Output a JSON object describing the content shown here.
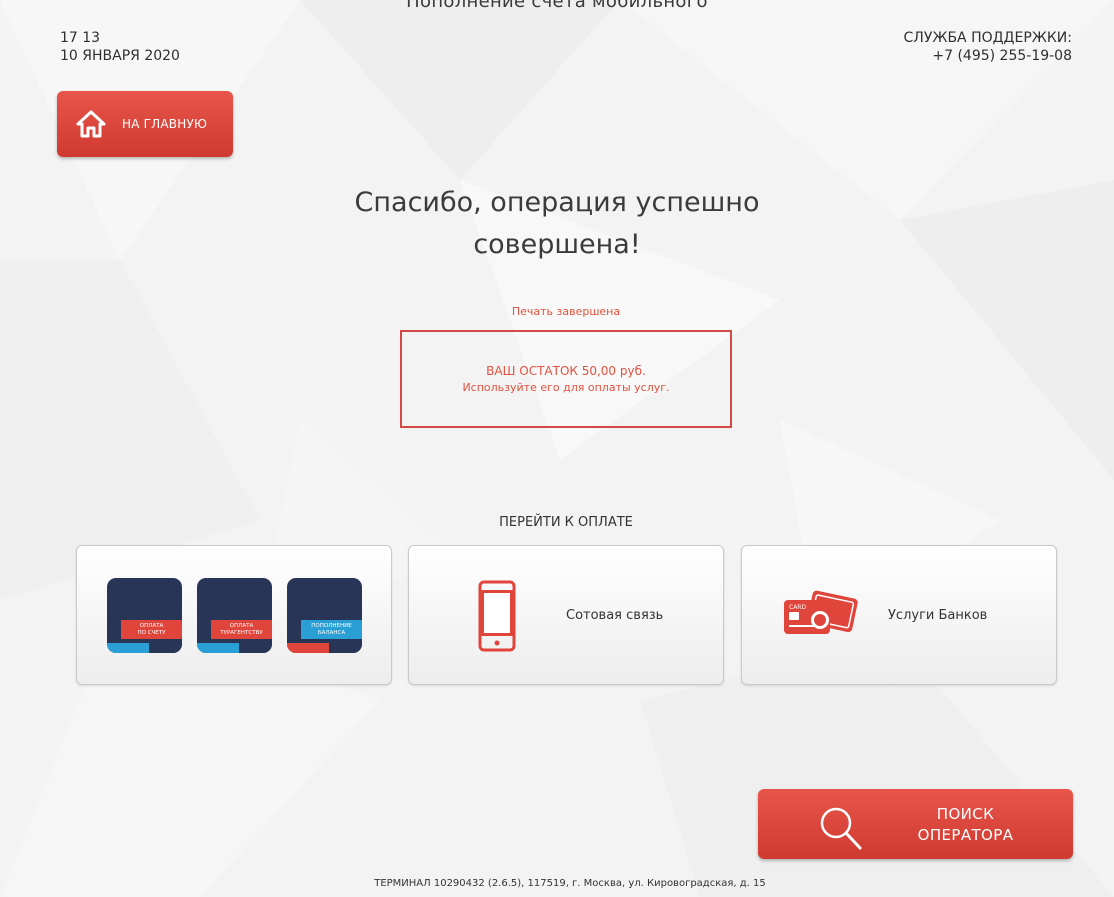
{
  "top_cut_text": "Пополнение счета мобильного",
  "clock": {
    "time": "17 13",
    "date": "10 ЯНВАРЯ 2020"
  },
  "support": {
    "label": "СЛУЖБА ПОДДЕРЖКИ:",
    "phone": "+7 (495) 255-19-08"
  },
  "home_button": {
    "label": "НА ГЛАВНУЮ",
    "icon": "home-icon"
  },
  "heading": {
    "line1": "Спасибо, операция успешно",
    "line2": "совершена!"
  },
  "print_status": "Печать завершена",
  "balance": {
    "line1": "ВАШ ОСТАТОК 50,00 руб.",
    "line2": "Используйте его для оплаты услуг."
  },
  "goto_label": "ПЕРЕЙТИ К ОПЛАТЕ",
  "tiles": [
    {
      "categories": [
        {
          "line1": "ОПЛАТА",
          "line2": "ПО СЧЕТУ"
        },
        {
          "line1": "ОПЛАТА",
          "line2": "ТУРАГЕНТСТВУ"
        },
        {
          "line1": "ПОПОЛНЕНИЕ",
          "line2": "БАЛАНСА"
        }
      ]
    },
    {
      "label": "Сотовая связь",
      "icon": "mobile-phone-icon"
    },
    {
      "label": "Услуги Банков",
      "icon": "bank-cards-icon",
      "card_text": "CARD"
    }
  ],
  "search_button": {
    "line1": "ПОИСК",
    "line2": "ОПЕРАТОРА",
    "icon": "search-icon"
  },
  "footer": "ТЕРМИНАЛ 10290432 (2.6.5), 117519, г. Москва, ул. Кировоградская, д. 15",
  "colors": {
    "accent": "#d9443a",
    "navy": "#283556",
    "blue": "#2a9fd6",
    "text": "#3a3a3a"
  }
}
